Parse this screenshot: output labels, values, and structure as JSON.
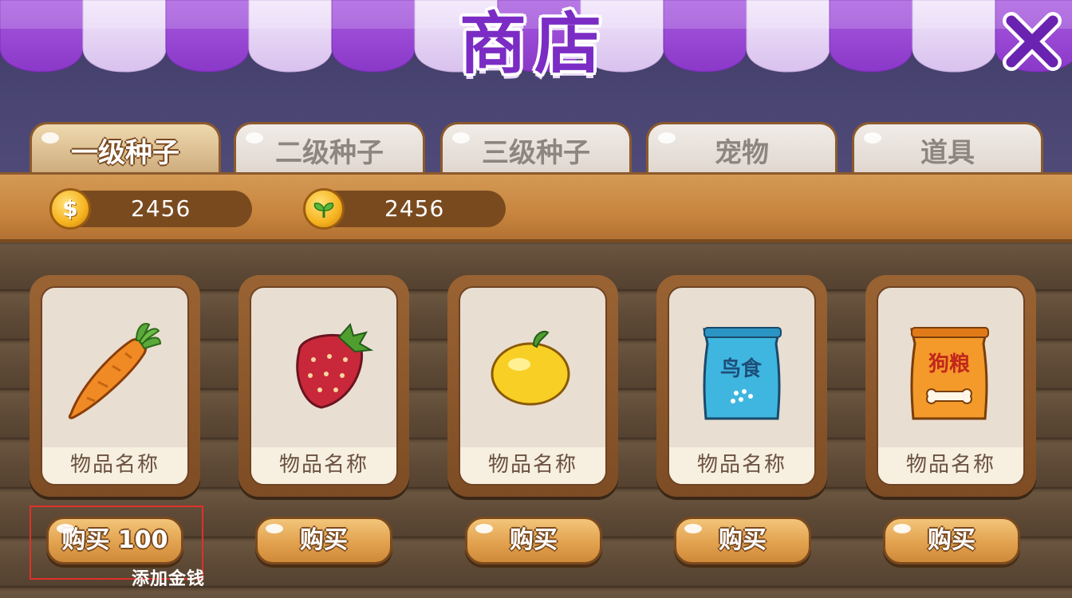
{
  "shop": {
    "title": "商店",
    "close_icon": "close-x-icon",
    "accent_purple": "#7b2cc4"
  },
  "tabs": [
    {
      "label": "一级种子",
      "active": true
    },
    {
      "label": "二级种子",
      "active": false
    },
    {
      "label": "三级种子",
      "active": false
    },
    {
      "label": "宠物",
      "active": false
    },
    {
      "label": "道具",
      "active": false
    }
  ],
  "currency": {
    "gold": {
      "icon": "gold-coin-icon",
      "symbol": "$",
      "value": "2456"
    },
    "seeds": {
      "icon": "sprout-coin-icon",
      "value": "2456"
    }
  },
  "items": [
    {
      "name": "物品名称",
      "icon": "carrot-icon",
      "buy_label": "购买 100"
    },
    {
      "name": "物品名称",
      "icon": "strawberry-icon",
      "buy_label": "购买"
    },
    {
      "name": "物品名称",
      "icon": "orange-fruit-icon",
      "buy_label": "购买"
    },
    {
      "name": "物品名称",
      "icon": "bird-food-bag-icon",
      "bag_text": "鸟食",
      "buy_label": "购买"
    },
    {
      "name": "物品名称",
      "icon": "dog-food-bag-icon",
      "bag_text": "狗粮",
      "buy_label": "购买"
    }
  ],
  "add_money_label": "添加金钱"
}
